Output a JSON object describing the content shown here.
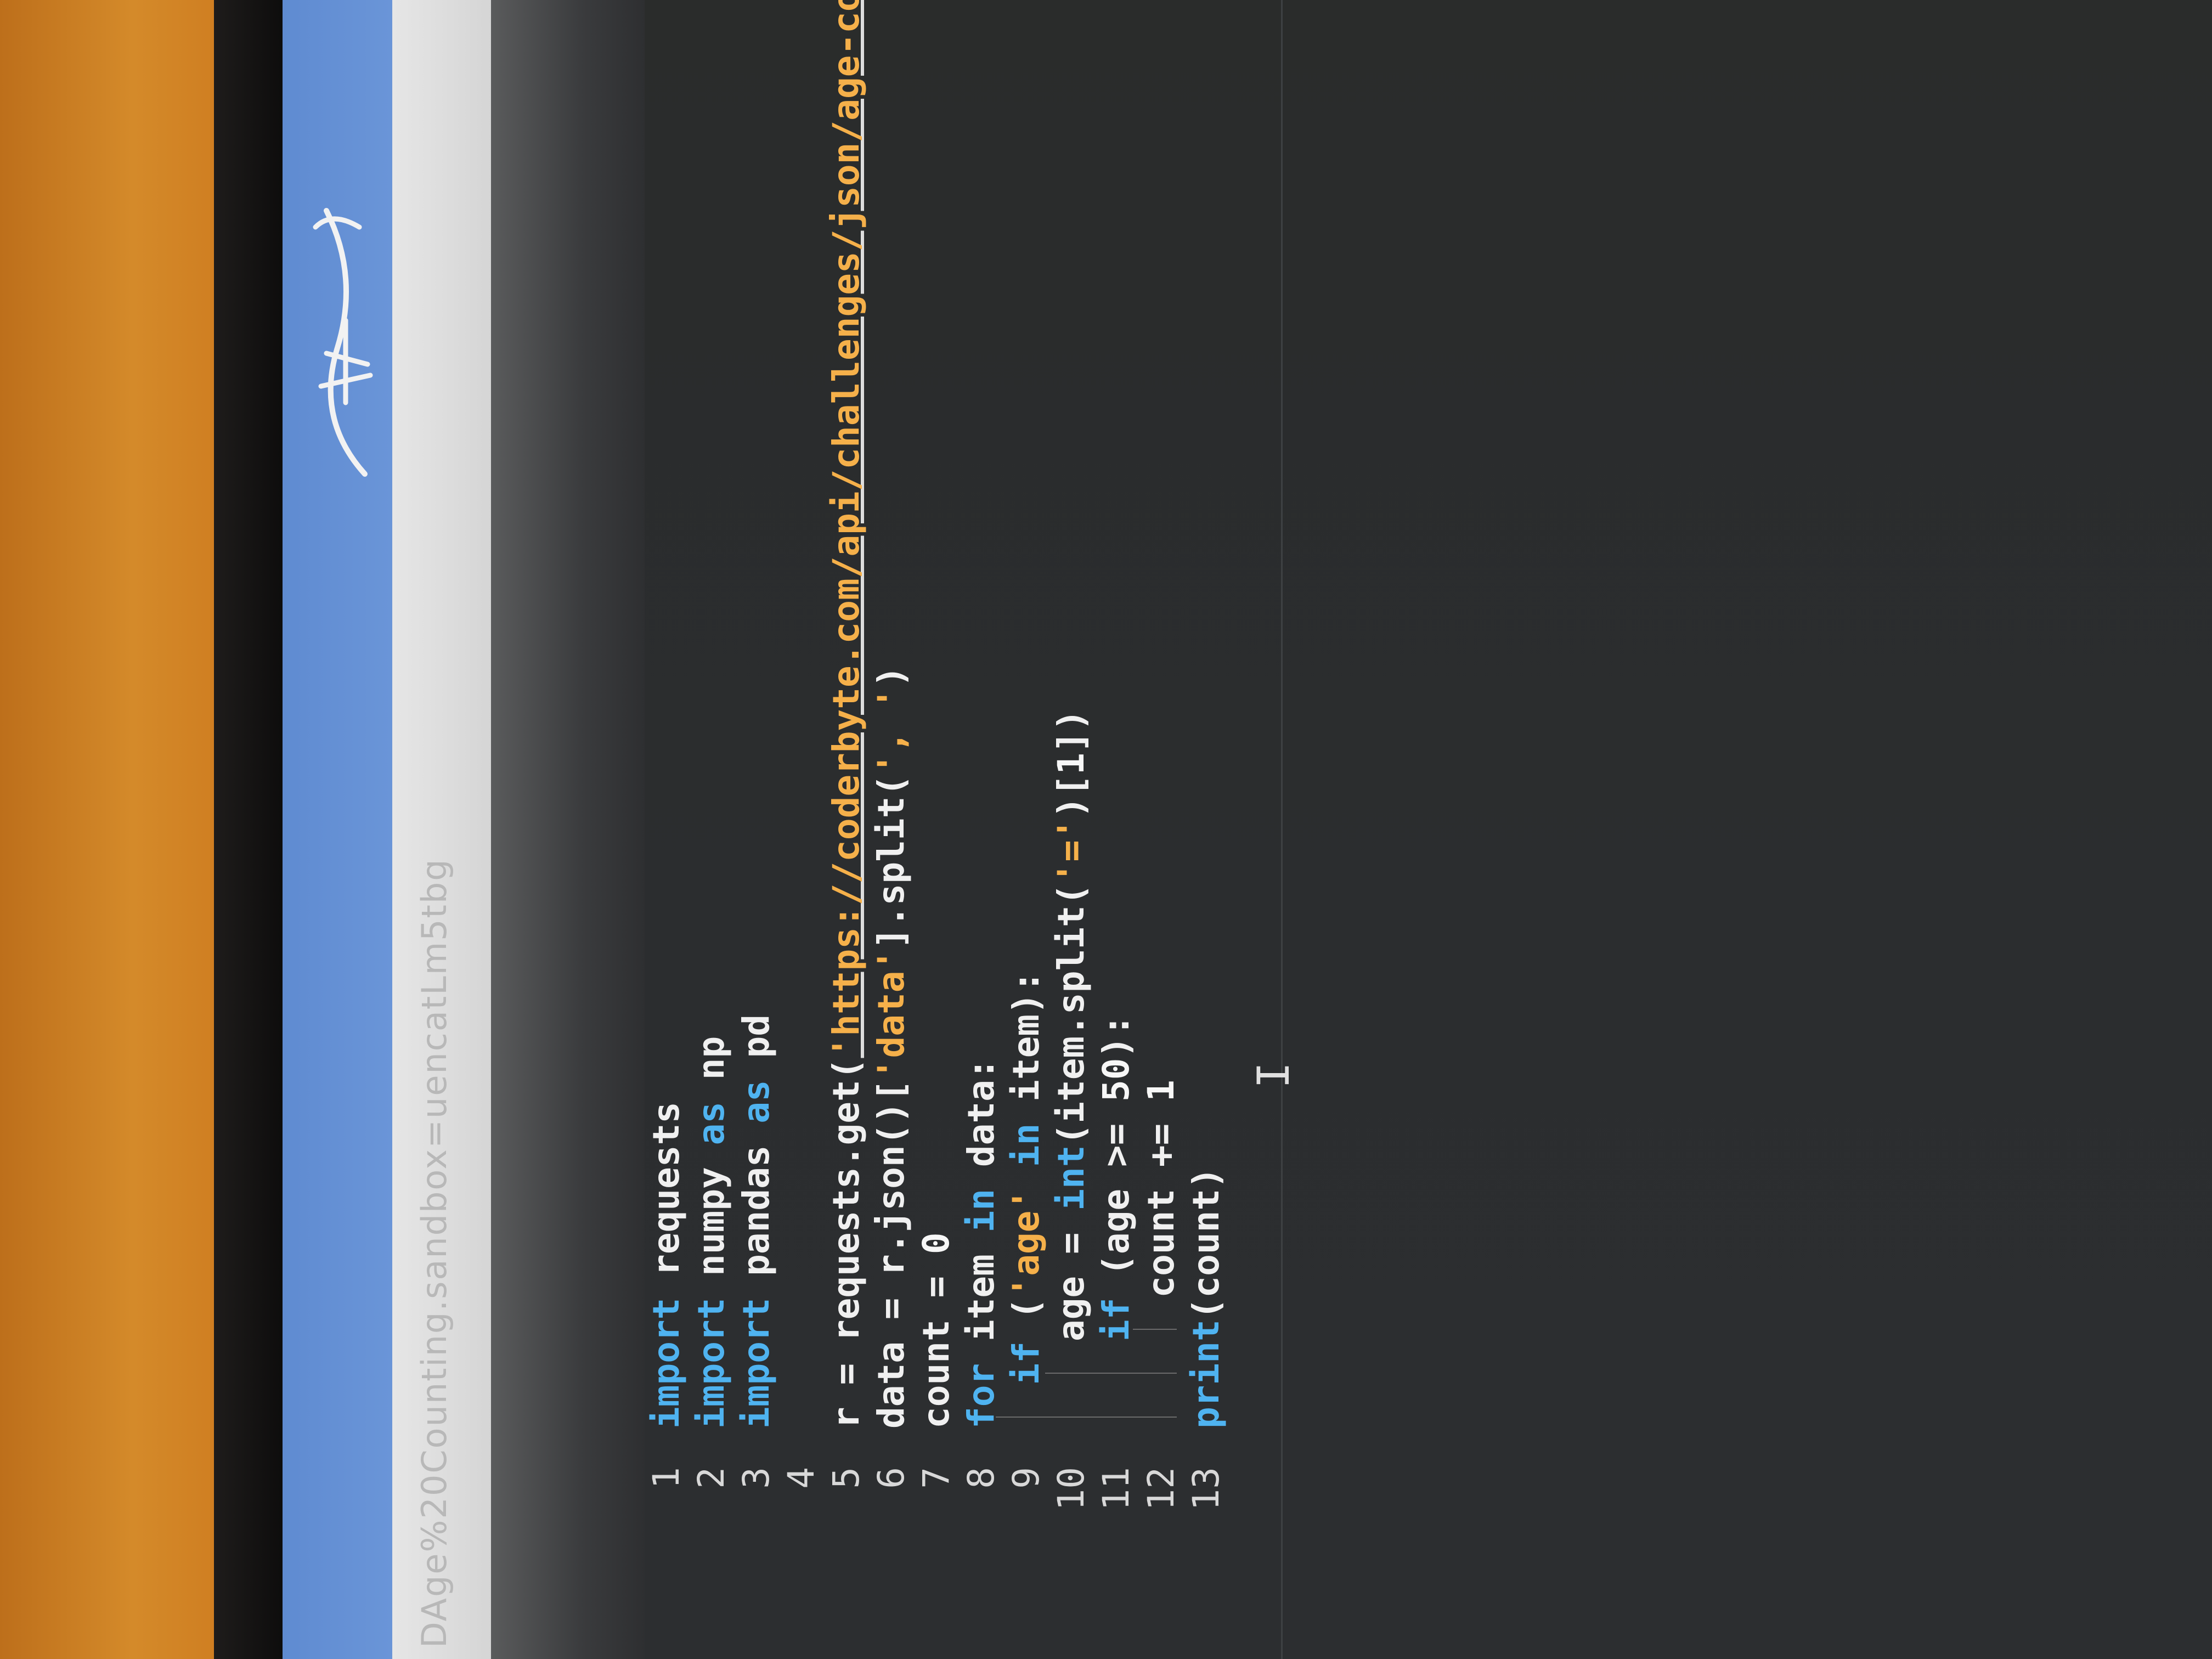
{
  "browser": {
    "url_fragment": "DAge%20Counting.sandbox=uencatLm5tbg"
  },
  "editor": {
    "lines": [
      {
        "n": "1",
        "tokens": [
          {
            "t": "import",
            "c": "kw"
          },
          {
            "t": " requests",
            "c": "id"
          }
        ]
      },
      {
        "n": "2",
        "tokens": [
          {
            "t": "import",
            "c": "kw"
          },
          {
            "t": " numpy ",
            "c": "id"
          },
          {
            "t": "as",
            "c": "kw"
          },
          {
            "t": " np",
            "c": "id"
          }
        ]
      },
      {
        "n": "3",
        "tokens": [
          {
            "t": "import",
            "c": "kw"
          },
          {
            "t": " pandas ",
            "c": "id"
          },
          {
            "t": "as",
            "c": "kw"
          },
          {
            "t": " pd",
            "c": "id"
          }
        ]
      },
      {
        "n": "4",
        "tokens": []
      },
      {
        "n": "5",
        "tokens": [
          {
            "t": "r = requests.get(",
            "c": "id"
          },
          {
            "t": "'https://coderbyte.com/api/challenges/json/age-counting'",
            "c": "str"
          },
          {
            "t": ")",
            "c": "id"
          }
        ]
      },
      {
        "n": "6",
        "tokens": [
          {
            "t": "data = r.json()[",
            "c": "id"
          },
          {
            "t": "'data'",
            "c": "str"
          },
          {
            "t": "].split(",
            "c": "id"
          },
          {
            "t": "', '",
            "c": "str"
          },
          {
            "t": ")",
            "c": "id"
          }
        ]
      },
      {
        "n": "7",
        "tokens": [
          {
            "t": "count = ",
            "c": "id"
          },
          {
            "t": "0",
            "c": "num"
          }
        ]
      },
      {
        "n": "8",
        "tokens": [
          {
            "t": "for",
            "c": "kw"
          },
          {
            "t": " item ",
            "c": "id"
          },
          {
            "t": "in",
            "c": "kw"
          },
          {
            "t": " data:",
            "c": "id"
          }
        ]
      },
      {
        "n": "9",
        "tokens": [
          {
            "t": "  ",
            "c": "id"
          },
          {
            "t": "if",
            "c": "kw"
          },
          {
            "t": " (",
            "c": "id"
          },
          {
            "t": "'age'",
            "c": "str"
          },
          {
            "t": " ",
            "c": "id"
          },
          {
            "t": "in",
            "c": "kw"
          },
          {
            "t": " item):",
            "c": "id"
          }
        ]
      },
      {
        "n": "10",
        "tokens": [
          {
            "t": "    age = ",
            "c": "id"
          },
          {
            "t": "int",
            "c": "kw"
          },
          {
            "t": "(item.split(",
            "c": "id"
          },
          {
            "t": "'='",
            "c": "str"
          },
          {
            "t": ")[",
            "c": "id"
          },
          {
            "t": "1",
            "c": "num"
          },
          {
            "t": "])",
            "c": "id"
          }
        ]
      },
      {
        "n": "11",
        "tokens": [
          {
            "t": "    ",
            "c": "id"
          },
          {
            "t": "if",
            "c": "kw"
          },
          {
            "t": " (age >= ",
            "c": "id"
          },
          {
            "t": "50",
            "c": "num"
          },
          {
            "t": "):",
            "c": "id"
          }
        ]
      },
      {
        "n": "12",
        "tokens": [
          {
            "t": "      count += ",
            "c": "id"
          },
          {
            "t": "1",
            "c": "num"
          }
        ]
      },
      {
        "n": "13",
        "tokens": [
          {
            "t": "print",
            "c": "kw"
          },
          {
            "t": "(count)",
            "c": "id"
          }
        ]
      }
    ]
  }
}
